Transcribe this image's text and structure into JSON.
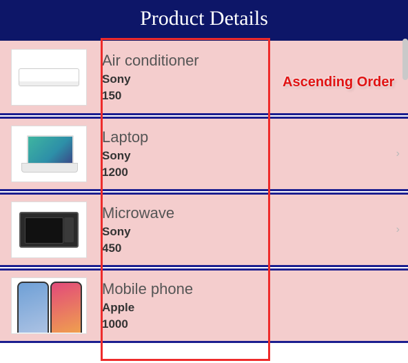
{
  "header": {
    "title": "Product Details"
  },
  "annotation": {
    "label": "Ascending Order"
  },
  "products": [
    {
      "name": "Air conditioner",
      "brand": "Sony",
      "price": "150",
      "glyph": "ac",
      "chevron": false
    },
    {
      "name": "Laptop",
      "brand": "Sony",
      "price": "1200",
      "glyph": "laptop",
      "chevron": true
    },
    {
      "name": "Microwave",
      "brand": "Sony",
      "price": "450",
      "glyph": "microwave",
      "chevron": true
    },
    {
      "name": "Mobile phone",
      "brand": "Apple",
      "price": "1000",
      "glyph": "phone",
      "chevron": false
    }
  ]
}
